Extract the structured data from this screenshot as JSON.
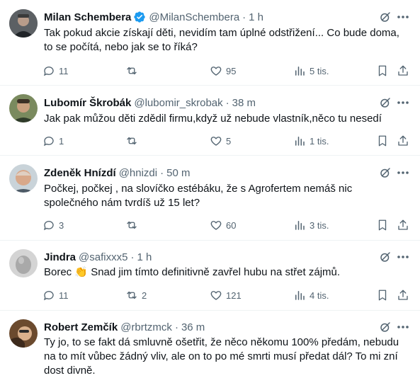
{
  "tweets": [
    {
      "name": "Milan Schembera",
      "verified": true,
      "handle": "@MilanSchembera",
      "dot": "·",
      "time": "1 h",
      "lines": [
        "Tak pokud akcie získají děti, nevidím tam úplné odstřižení... Co bude doma,",
        "to se počítá, nebo jak se to říká?"
      ],
      "replies": "11",
      "retweets": "",
      "likes": "95",
      "views": "5 tis."
    },
    {
      "name": "Lubomír Škrobák",
      "verified": false,
      "handle": "@lubomir_skrobak",
      "dot": "·",
      "time": "38 m",
      "lines": [
        "Jak pak můžou děti zdědil firmu,když už nebude vlastník,něco tu nesedí"
      ],
      "replies": "1",
      "retweets": "",
      "likes": "5",
      "views": "1 tis."
    },
    {
      "name": "Zdeněk Hnízdí",
      "verified": false,
      "handle": "@hnizdi",
      "dot": "·",
      "time": "50 m",
      "lines": [
        "Počkej, počkej , na slovíčko estébáku, že s Agrofertem nemáš nic",
        "společného nám tvrdíš už 15 let?"
      ],
      "replies": "3",
      "retweets": "",
      "likes": "60",
      "views": "3 tis."
    },
    {
      "name": "Jindra",
      "verified": false,
      "handle": "@safixxx5",
      "dot": "·",
      "time": "1 h",
      "lines": [
        "Borec 👏 Snad jim tímto definitivně zavřel hubu na střet zájmů."
      ],
      "replies": "11",
      "retweets": "2",
      "likes": "121",
      "views": "4 tis."
    },
    {
      "name": "Robert Zemčík",
      "verified": false,
      "handle": "@rbrtzmck",
      "dot": "·",
      "time": "36 m",
      "lines": [
        "Ty jo, to se fakt dá smluvně ošetřit, že něco někomu 100% předám, nebudu",
        "na to mít vůbec žádný vliv, ale on to po mé smrti musí předat dál? To mi zní",
        "dost divně."
      ],
      "replies": "",
      "retweets": "",
      "likes": "",
      "views": ""
    }
  ],
  "colors": {
    "text": "#0f1419",
    "secondary": "#536471",
    "verified": "#1d9bf0",
    "divider": "#eff3f4"
  },
  "icons": [
    "verified-badge-icon",
    "grok-icon",
    "more-icon",
    "reply-icon",
    "retweet-icon",
    "like-icon",
    "views-icon",
    "bookmark-icon",
    "share-icon"
  ]
}
